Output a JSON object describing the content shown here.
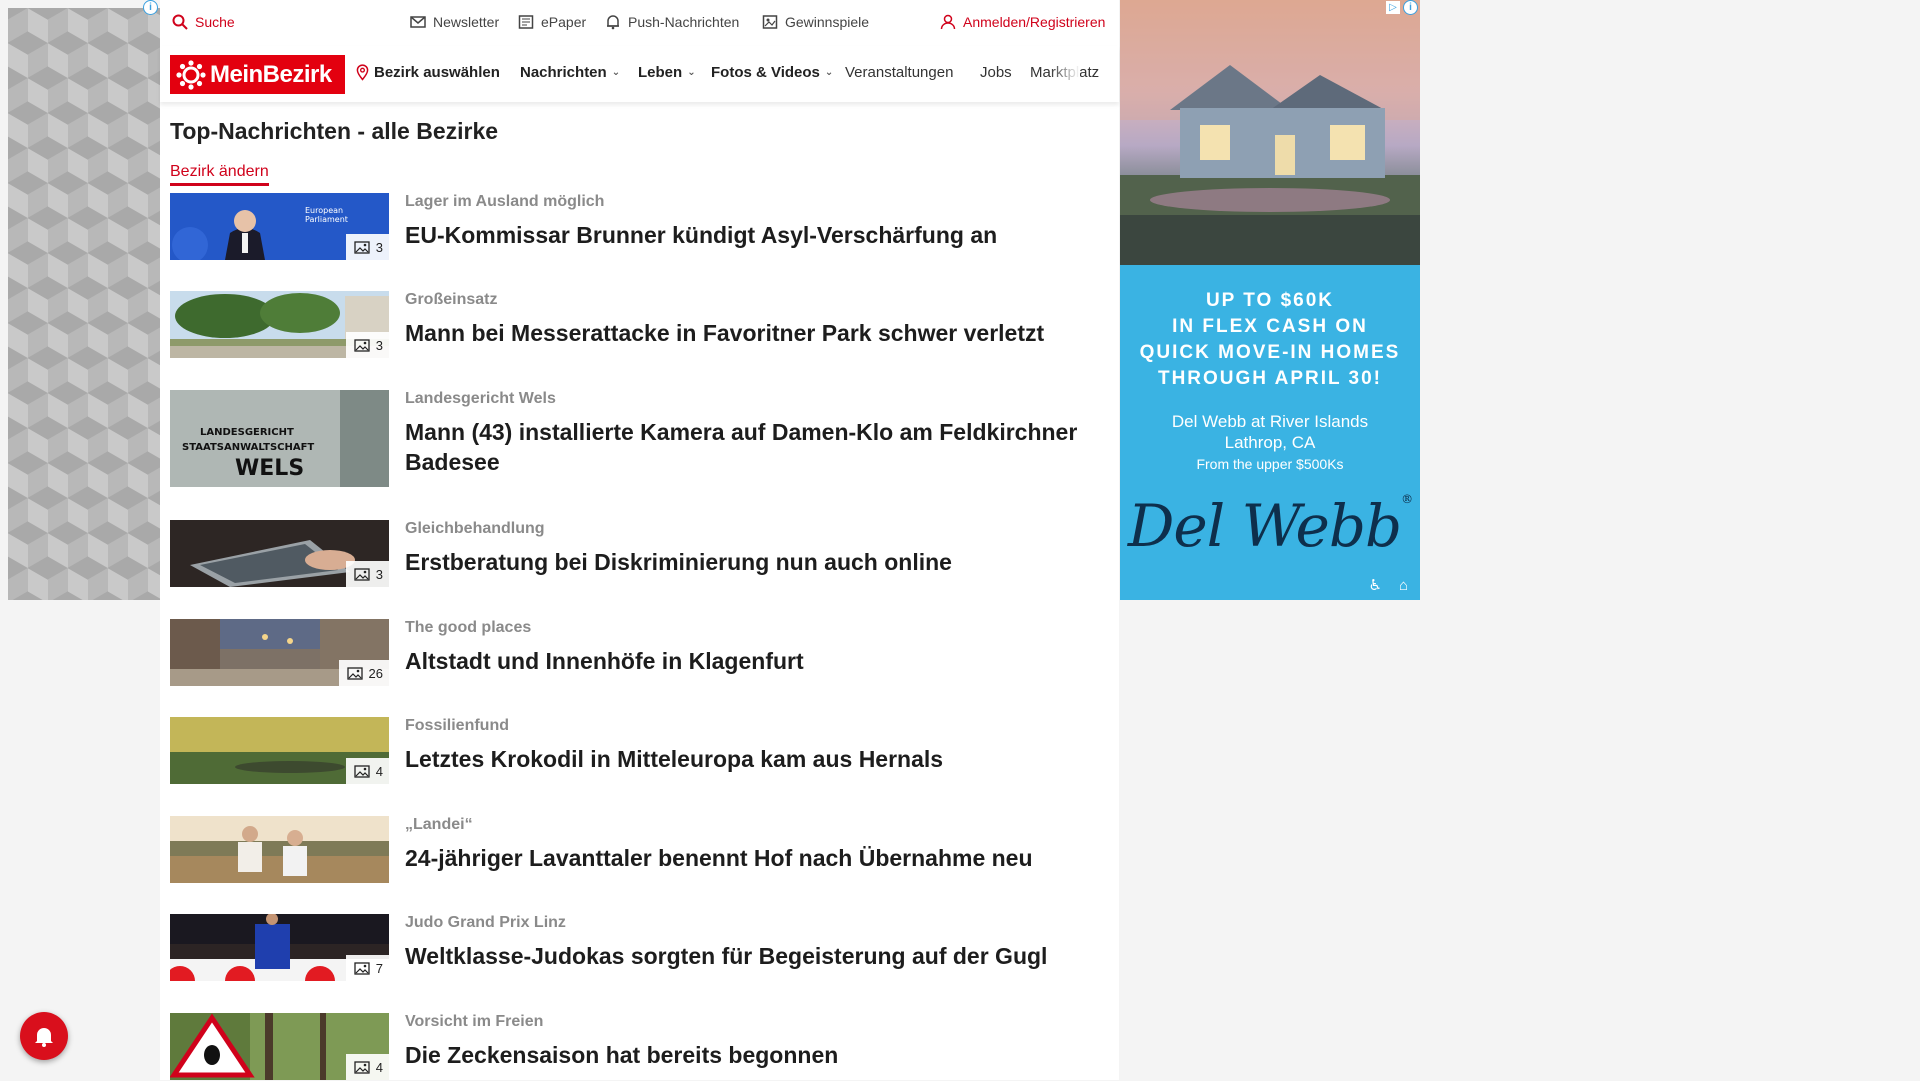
{
  "utility": {
    "search": "Suche",
    "newsletter": "Newsletter",
    "epaper": "ePaper",
    "push": "Push-Nachrichten",
    "gewinnspiele": "Gewinnspiele",
    "login": "Anmelden/Registrieren"
  },
  "nav": {
    "logo": "MeinBezirk",
    "district": "Bezirk auswählen",
    "items": [
      {
        "label": "Nachrichten",
        "dropdown": true
      },
      {
        "label": "Leben",
        "dropdown": true
      },
      {
        "label": "Fotos & Videos",
        "dropdown": true
      },
      {
        "label": "Veranstaltungen",
        "dropdown": false
      },
      {
        "label": "Jobs",
        "dropdown": false
      },
      {
        "label": "Marktplatz",
        "dropdown": false
      }
    ]
  },
  "main": {
    "title": "Top-Nachrichten - alle Bezirke",
    "change_link": "Bezirk ändern",
    "articles": [
      {
        "kicker": "Lager im Ausland möglich",
        "headline": "EU-Kommissar Brunner kündigt Asyl-Verschärfung an",
        "photos": "3",
        "thumb": "parliament"
      },
      {
        "kicker": "Großeinsatz",
        "headline": "Mann bei Messerattacke in Favoritner Park schwer verletzt",
        "photos": "3",
        "thumb": "park"
      },
      {
        "kicker": "Landesgericht Wels",
        "headline": "Mann (43) installierte Kamera auf Damen-Klo am Feldkirchner Badesee",
        "photos": "",
        "thumb": "court",
        "thumb_text": [
          "LANDESGERICHT",
          "STAATSANWALTSCHAFT",
          "WELS"
        ]
      },
      {
        "kicker": "Gleichbehandlung",
        "headline": "Erstberatung bei Diskriminierung nun auch online",
        "photos": "3",
        "thumb": "tablet"
      },
      {
        "kicker": "The good places",
        "headline": "Altstadt und Innenhöfe in Klagenfurt",
        "photos": "26",
        "thumb": "street"
      },
      {
        "kicker": "Fossilienfund",
        "headline": "Letztes Krokodil in Mitteleuropa kam aus Hernals",
        "photos": "4",
        "thumb": "croc"
      },
      {
        "kicker": "„Landei“",
        "headline": "24-jähriger Lavanttaler benennt Hof nach Übernahme neu",
        "photos": "",
        "thumb": "farm"
      },
      {
        "kicker": "Judo Grand Prix Linz",
        "headline": "Weltklasse-Judokas sorgten für Begeisterung auf der Gugl",
        "photos": "7",
        "thumb": "judo"
      },
      {
        "kicker": "Vorsicht im Freien",
        "headline": "Die Zeckensaison hat bereits begonnen",
        "photos": "4",
        "thumb": "tick"
      }
    ]
  },
  "ad": {
    "line1": "UP TO $60K",
    "line2": "IN FLEX CASH ON",
    "line3": "QUICK MOVE-IN HOMES",
    "line4": "THROUGH APRIL 30!",
    "community": "Del Webb at River Islands",
    "location": "Lathrop, CA",
    "price": "From the upper $500Ks",
    "brand": "Del Webb",
    "registered": "®"
  },
  "colors": {
    "brand_red": "#e3000f",
    "ad_blue": "#3ab3e3"
  }
}
